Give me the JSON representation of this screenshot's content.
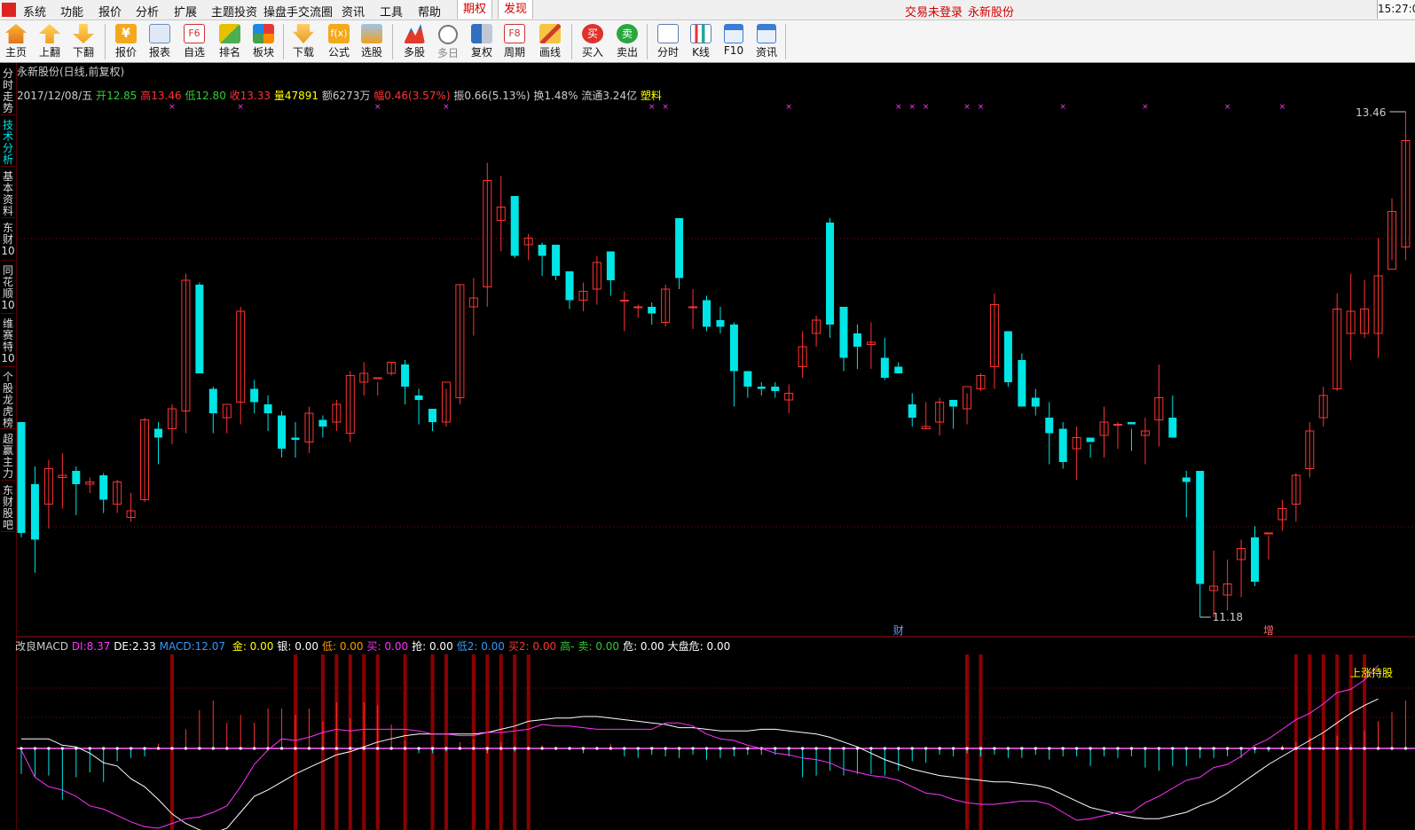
{
  "menubar": {
    "items": [
      "系统",
      "功能",
      "报价",
      "分析",
      "扩展",
      "主题投资",
      "操盘手交流圈",
      "资讯",
      "工具",
      "帮助"
    ],
    "highlight_items": [
      "期权",
      "发现"
    ],
    "status_login": "交易未登录",
    "status_stock": "永新股份",
    "clock": "15:27:0"
  },
  "toolbar": {
    "buttons": [
      "主页",
      "上翻",
      "下翻",
      "报价",
      "报表",
      "自选",
      "排名",
      "板块",
      "下载",
      "公式",
      "选股",
      "多股",
      "多日",
      "复权",
      "周期",
      "画线",
      "买入",
      "卖出",
      "分时",
      "K线",
      "F10",
      "资讯"
    ],
    "icon_f6": "F6",
    "icon_f8": "F8",
    "icon_buy": "买",
    "icon_sell": "卖"
  },
  "sidetabs": [
    "分时走势",
    "技术分析",
    "基本资料",
    "东财10",
    "同花顺10",
    "维赛特10",
    "个股龙虎榜",
    "超赢主力",
    "东财股吧"
  ],
  "stock_header": {
    "title": "永新股份(日线,前复权)",
    "date": "2017/12/08/五",
    "open_label": "开",
    "open": "12.85",
    "high_label": "高",
    "high": "13.46",
    "low_label": "低",
    "low": "12.80",
    "close_label": "收",
    "close": "13.33",
    "volume_label": "量",
    "volume": "47891",
    "amount_label": "额",
    "amount": "6273万",
    "change_label": "幅",
    "change": "0.46(3.57%)",
    "amplitude_label": "振",
    "amplitude": "0.66(5.13%)",
    "turnover_label": "换",
    "turnover": "1.48%",
    "float_label": "流通",
    "float": "3.24亿",
    "industry": "塑料"
  },
  "price_chart": {
    "max_label": "13.46",
    "min_label": "11.18",
    "event_fin": "财",
    "event_add": "增"
  },
  "macd_header": {
    "name": "改良MACD",
    "di_label": "DI:",
    "di": "8.37",
    "de_label": "DE:",
    "de": "2.33",
    "macd_label": "MACD:",
    "macd": "12.07",
    "items": [
      {
        "label": "金:",
        "value": "0.00",
        "color": "#ffff00"
      },
      {
        "label": "银:",
        "value": "0.00",
        "color": "#ffffff"
      },
      {
        "label": "低:",
        "value": "0.00",
        "color": "#ff9900"
      },
      {
        "label": "买:",
        "value": "0.00",
        "color": "#ff33ff"
      },
      {
        "label": "抢:",
        "value": "0.00",
        "color": "#ffffff"
      },
      {
        "label": "低2:",
        "value": "0.00",
        "color": "#3399ff"
      },
      {
        "label": "买2:",
        "value": "0.00",
        "color": "#ff3333"
      },
      {
        "label": "高-",
        "value": "",
        "color": "#33cc33"
      },
      {
        "label": "卖:",
        "value": "0.00",
        "color": "#33cc33"
      },
      {
        "label": "危:",
        "value": "0.00",
        "color": "#ffffff"
      },
      {
        "label": "大盘危:",
        "value": "0.00",
        "color": "#ffffff"
      }
    ],
    "signal": "上涨持股"
  },
  "colors": {
    "up": "#ff3333",
    "down": "#00e5e5",
    "di": "#ff33ff",
    "de": "#ffffff",
    "signal_bar": "#8b0000"
  },
  "chart_data": {
    "type": "candlestick",
    "ylim": [
      11.18,
      13.46
    ],
    "candles": [
      [
        12.06,
        11.56,
        12.06,
        11.54
      ],
      [
        11.78,
        11.53,
        11.86,
        11.38
      ],
      [
        11.69,
        11.85,
        11.89,
        11.58
      ],
      [
        11.81,
        11.82,
        11.92,
        11.67
      ],
      [
        11.84,
        11.78,
        11.86,
        11.64
      ],
      [
        11.78,
        11.79,
        11.81,
        11.74
      ],
      [
        11.82,
        11.71,
        11.83,
        11.65
      ],
      [
        11.69,
        11.79,
        11.8,
        11.65
      ],
      [
        11.63,
        11.66,
        11.74,
        11.61
      ],
      [
        11.71,
        12.07,
        12.08,
        11.7
      ],
      [
        12.03,
        11.99,
        12.06,
        11.87
      ],
      [
        12.03,
        12.12,
        12.14,
        11.96
      ],
      [
        12.11,
        12.7,
        12.73,
        12.01
      ],
      [
        12.68,
        12.28,
        12.69,
        12.28
      ],
      [
        12.21,
        12.1,
        12.22,
        12.01
      ],
      [
        12.08,
        12.14,
        12.13,
        12.01
      ],
      [
        12.15,
        12.56,
        12.58,
        12.05
      ],
      [
        12.21,
        12.15,
        12.25,
        12.1
      ],
      [
        12.14,
        12.1,
        12.18,
        12.02
      ],
      [
        12.09,
        11.94,
        12.11,
        11.9
      ],
      [
        11.99,
        11.98,
        12.06,
        11.9
      ],
      [
        11.97,
        12.1,
        12.13,
        11.92
      ],
      [
        12.07,
        12.04,
        12.09,
        11.99
      ],
      [
        12.06,
        12.14,
        12.16,
        12.02
      ],
      [
        12.01,
        12.27,
        12.29,
        11.97
      ],
      [
        12.24,
        12.28,
        12.33,
        12.18
      ],
      [
        12.26,
        12.26,
        12.24,
        12.18
      ],
      [
        12.28,
        12.33,
        12.33,
        12.27
      ],
      [
        12.32,
        12.22,
        12.34,
        12.14
      ],
      [
        12.18,
        12.16,
        12.21,
        12.05
      ],
      [
        12.12,
        12.06,
        12.12,
        12.02
      ],
      [
        12.06,
        12.24,
        12.21,
        12.04
      ],
      [
        12.17,
        12.68,
        12.68,
        12.14
      ],
      [
        12.58,
        12.62,
        12.71,
        12.45
      ],
      [
        12.67,
        13.15,
        13.23,
        12.58
      ],
      [
        12.97,
        13.03,
        13.17,
        12.83
      ],
      [
        13.08,
        12.81,
        13.07,
        12.8
      ],
      [
        12.86,
        12.89,
        12.91,
        12.79
      ],
      [
        12.86,
        12.81,
        12.87,
        12.72
      ],
      [
        12.86,
        12.72,
        12.83,
        12.7
      ],
      [
        12.74,
        12.61,
        12.72,
        12.57
      ],
      [
        12.61,
        12.65,
        12.69,
        12.56
      ],
      [
        12.66,
        12.78,
        12.81,
        12.59
      ],
      [
        12.83,
        12.7,
        12.81,
        12.63
      ],
      [
        12.61,
        12.61,
        12.65,
        12.47
      ],
      [
        12.58,
        12.58,
        12.59,
        12.53
      ],
      [
        12.58,
        12.55,
        12.6,
        12.5
      ],
      [
        12.51,
        12.66,
        12.68,
        12.49
      ],
      [
        12.98,
        12.71,
        12.94,
        12.66
      ],
      [
        12.58,
        12.58,
        12.66,
        12.48
      ],
      [
        12.61,
        12.49,
        12.63,
        12.47
      ],
      [
        12.52,
        12.49,
        12.58,
        12.46
      ],
      [
        12.5,
        12.29,
        12.51,
        12.13
      ],
      [
        12.29,
        12.22,
        12.27,
        12.17
      ],
      [
        12.22,
        12.21,
        12.24,
        12.18
      ],
      [
        12.22,
        12.2,
        12.24,
        12.17
      ],
      [
        12.16,
        12.19,
        12.23,
        12.1
      ],
      [
        12.31,
        12.4,
        12.47,
        12.26
      ],
      [
        12.46,
        12.52,
        12.54,
        12.4
      ],
      [
        12.96,
        12.5,
        12.98,
        12.44
      ],
      [
        12.58,
        12.35,
        12.55,
        12.29
      ],
      [
        12.46,
        12.4,
        12.5,
        12.3
      ],
      [
        12.41,
        12.42,
        12.51,
        12.3
      ],
      [
        12.35,
        12.26,
        12.44,
        12.25
      ],
      [
        12.31,
        12.28,
        12.33,
        12.28
      ],
      [
        12.14,
        12.08,
        12.19,
        12.04
      ],
      [
        12.03,
        12.04,
        12.15,
        12.03
      ],
      [
        12.06,
        12.15,
        12.17,
        12.0
      ],
      [
        12.16,
        12.13,
        12.16,
        12.03
      ],
      [
        12.12,
        12.22,
        12.19,
        12.05
      ],
      [
        12.21,
        12.27,
        12.28,
        12.2
      ],
      [
        12.31,
        12.59,
        12.64,
        12.21
      ],
      [
        12.47,
        12.24,
        12.46,
        12.22
      ],
      [
        12.34,
        12.13,
        12.37,
        12.13
      ],
      [
        12.17,
        12.13,
        12.21,
        12.09
      ],
      [
        12.08,
        12.01,
        12.15,
        11.87
      ],
      [
        12.03,
        11.88,
        12.06,
        11.85
      ],
      [
        11.94,
        11.99,
        12.04,
        11.8
      ],
      [
        11.99,
        11.97,
        11.96,
        11.9
      ],
      [
        12.0,
        12.06,
        12.13,
        11.9
      ],
      [
        12.05,
        12.05,
        12.06,
        11.94
      ],
      [
        12.06,
        12.05,
        12.03,
        11.93
      ],
      [
        12.0,
        12.02,
        12.08,
        11.87
      ],
      [
        12.07,
        12.17,
        12.32,
        11.95
      ],
      [
        12.08,
        11.99,
        12.18,
        12.0
      ],
      [
        11.81,
        11.79,
        11.84,
        11.63
      ],
      [
        11.84,
        11.33,
        11.84,
        11.18
      ],
      [
        11.3,
        11.32,
        11.48,
        11.18
      ],
      [
        11.28,
        11.33,
        11.44,
        11.21
      ],
      [
        11.44,
        11.49,
        11.53,
        11.27
      ],
      [
        11.54,
        11.34,
        11.59,
        11.32
      ],
      [
        11.56,
        11.56,
        11.55,
        11.44
      ],
      [
        11.62,
        11.67,
        11.71,
        11.57
      ],
      [
        11.69,
        11.82,
        11.83,
        11.61
      ],
      [
        11.85,
        12.02,
        12.06,
        11.81
      ],
      [
        12.08,
        12.18,
        12.22,
        12.04
      ],
      [
        12.21,
        12.57,
        12.64,
        12.2
      ],
      [
        12.46,
        12.56,
        12.73,
        12.34
      ],
      [
        12.46,
        12.57,
        12.7,
        12.44
      ],
      [
        12.46,
        12.72,
        12.89,
        12.35
      ],
      [
        12.75,
        13.01,
        13.07,
        12.79
      ],
      [
        12.85,
        13.33,
        13.46,
        12.79
      ]
    ],
    "macd": {
      "di": [
        -0.01,
        -0.18,
        -0.24,
        -0.26,
        -0.3,
        -0.36,
        -0.38,
        -0.42,
        -0.46,
        -0.49,
        -0.5,
        -0.47,
        -0.44,
        -0.43,
        -0.4,
        -0.36,
        -0.24,
        -0.1,
        -0.01,
        0.06,
        0.05,
        0.07,
        0.1,
        0.12,
        0.11,
        0.12,
        0.12,
        0.12,
        0.12,
        0.11,
        0.09,
        0.09,
        0.08,
        0.08,
        0.1,
        0.1,
        0.11,
        0.12,
        0.15,
        0.14,
        0.14,
        0.13,
        0.12,
        0.12,
        0.12,
        0.12,
        0.12,
        0.16,
        0.16,
        0.14,
        0.09,
        0.06,
        0.05,
        0.02,
        0.0,
        -0.03,
        -0.04,
        -0.06,
        -0.07,
        -0.09,
        -0.13,
        -0.15,
        -0.17,
        -0.18,
        -0.2,
        -0.24,
        -0.28,
        -0.29,
        -0.32,
        -0.34,
        -0.35,
        -0.35,
        -0.34,
        -0.33,
        -0.33,
        -0.35,
        -0.4,
        -0.45,
        -0.44,
        -0.42,
        -0.4,
        -0.4,
        -0.34,
        -0.3,
        -0.25,
        -0.2,
        -0.18,
        -0.12,
        -0.1,
        -0.05,
        0.02,
        0.06,
        0.12,
        0.18,
        0.22,
        0.28,
        0.35,
        0.37,
        0.43,
        0.52
      ],
      "de": [
        0.06,
        0.06,
        0.06,
        0.02,
        0.01,
        -0.03,
        -0.09,
        -0.11,
        -0.19,
        -0.24,
        -0.32,
        -0.41,
        -0.47,
        -0.51,
        -0.53,
        -0.5,
        -0.4,
        -0.3,
        -0.26,
        -0.21,
        -0.16,
        -0.12,
        -0.08,
        -0.04,
        -0.02,
        0.01,
        0.04,
        0.06,
        0.08,
        0.09,
        0.09,
        0.09,
        0.09,
        0.09,
        0.1,
        0.12,
        0.14,
        0.17,
        0.18,
        0.19,
        0.19,
        0.2,
        0.2,
        0.19,
        0.18,
        0.17,
        0.16,
        0.15,
        0.13,
        0.13,
        0.12,
        0.11,
        0.11,
        0.11,
        0.12,
        0.12,
        0.11,
        0.1,
        0.09,
        0.07,
        0.04,
        0.01,
        -0.03,
        -0.07,
        -0.1,
        -0.13,
        -0.15,
        -0.17,
        -0.18,
        -0.19,
        -0.2,
        -0.21,
        -0.21,
        -0.22,
        -0.23,
        -0.25,
        -0.29,
        -0.33,
        -0.37,
        -0.39,
        -0.41,
        -0.43,
        -0.44,
        -0.44,
        -0.42,
        -0.4,
        -0.36,
        -0.33,
        -0.28,
        -0.22,
        -0.16,
        -0.1,
        -0.05,
        0.0,
        0.05,
        0.1,
        0.16,
        0.22,
        0.27,
        0.31
      ],
      "histogram": [
        -0.16,
        -0.18,
        -0.17,
        -0.32,
        -0.18,
        -0.15,
        -0.21,
        -0.08,
        -0.06,
        -0.05,
        0.03,
        0.0,
        0.12,
        0.24,
        0.3,
        0.16,
        0.21,
        0.16,
        0.25,
        0.25,
        0.21,
        0.25,
        0.17,
        0.29,
        0.19,
        0.29,
        0.27,
        0.15,
        0.05,
        -0.03,
        -0.03,
        -0.02,
        0.04,
        0.06,
        -0.03,
        0.04,
        -0.02,
        0.0,
        0.02,
        0.0,
        0.0,
        -0.03,
        0.01,
        0.03,
        -0.05,
        -0.06,
        -0.04,
        -0.05,
        -0.06,
        -0.04,
        -0.07,
        -0.06,
        -0.05,
        -0.04,
        -0.04,
        -0.04,
        -0.05,
        -0.18,
        -0.17,
        -0.14,
        -0.17,
        -0.16,
        -0.16,
        -0.17,
        -0.14,
        -0.08,
        -0.09,
        -0.04,
        -0.05,
        -0.03,
        -0.05,
        -0.04,
        -0.06,
        -0.06,
        -0.04,
        -0.07,
        -0.05,
        -0.05,
        -0.11,
        -0.05,
        -0.06,
        -0.05,
        -0.12,
        -0.14,
        -0.11,
        -0.11,
        -0.06,
        -0.06,
        -0.05,
        -0.06,
        -0.03,
        -0.02,
        0.02,
        0.04,
        0.07,
        0.09,
        0.08,
        0.03,
        0.11,
        0.17,
        0.23,
        0.3
      ]
    },
    "signal_indices": [
      11,
      20,
      22,
      23,
      24,
      25,
      26,
      28,
      30,
      31,
      33,
      34,
      35,
      36,
      37,
      69,
      70,
      93,
      94,
      95,
      96,
      97,
      98
    ]
  }
}
